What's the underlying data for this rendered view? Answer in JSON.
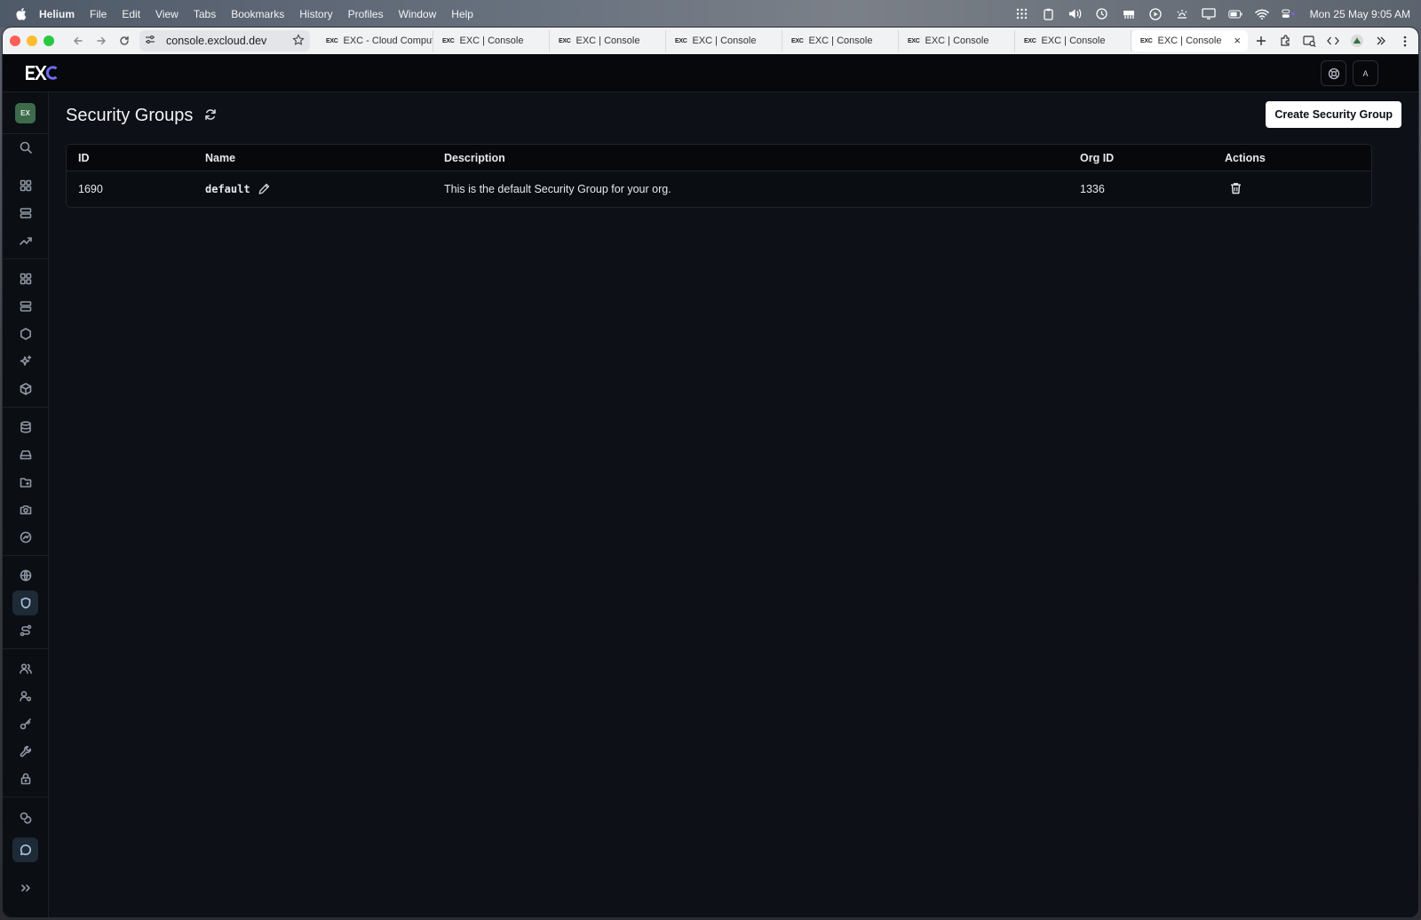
{
  "menubar": {
    "app_name": "Helium",
    "items": [
      "File",
      "Edit",
      "View",
      "Tabs",
      "Bookmarks",
      "History",
      "Profiles",
      "Window",
      "Help"
    ],
    "clock": "Mon 25 May  9:05 AM",
    "status_icons": [
      "grid-icon",
      "clipboard-icon",
      "volume-icon",
      "clock-icon",
      "memory-icon",
      "play-icon",
      "weather-icon",
      "display-icon",
      "battery-icon",
      "wifi-icon",
      "control-center-icon"
    ]
  },
  "browser": {
    "url": "console.excloud.dev",
    "tabs": [
      {
        "favicon": "EXC",
        "title": "EXC - Cloud Computi",
        "active": false
      },
      {
        "favicon": "EXC",
        "title": "EXC | Console",
        "active": false
      },
      {
        "favicon": "EXC",
        "title": "EXC | Console",
        "active": false
      },
      {
        "favicon": "EXC",
        "title": "EXC | Console",
        "active": false
      },
      {
        "favicon": "EXC",
        "title": "EXC | Console",
        "active": false
      },
      {
        "favicon": "EXC",
        "title": "EXC | Console",
        "active": false
      },
      {
        "favicon": "EXC",
        "title": "EXC | Console",
        "active": false
      },
      {
        "favicon": "EXC",
        "title": "EXC | Console",
        "active": true
      }
    ],
    "close_glyph": "×"
  },
  "header": {
    "logo_text": "EXC",
    "avatar_initial": "A"
  },
  "sidebar": {
    "org_badge": "EX",
    "active_item": "security-groups"
  },
  "page": {
    "title": "Security Groups",
    "create_button": "Create Security Group"
  },
  "table": {
    "columns": [
      "ID",
      "Name",
      "Description",
      "Org ID",
      "Actions"
    ],
    "rows": [
      {
        "id": "1690",
        "name": "default",
        "description": "This is the default Security Group for your org.",
        "org_id": "1336"
      }
    ]
  },
  "colors": {
    "accent_logo": "#6d6df2",
    "background": "#0d1016",
    "org_badge": "#3d6b4c"
  }
}
